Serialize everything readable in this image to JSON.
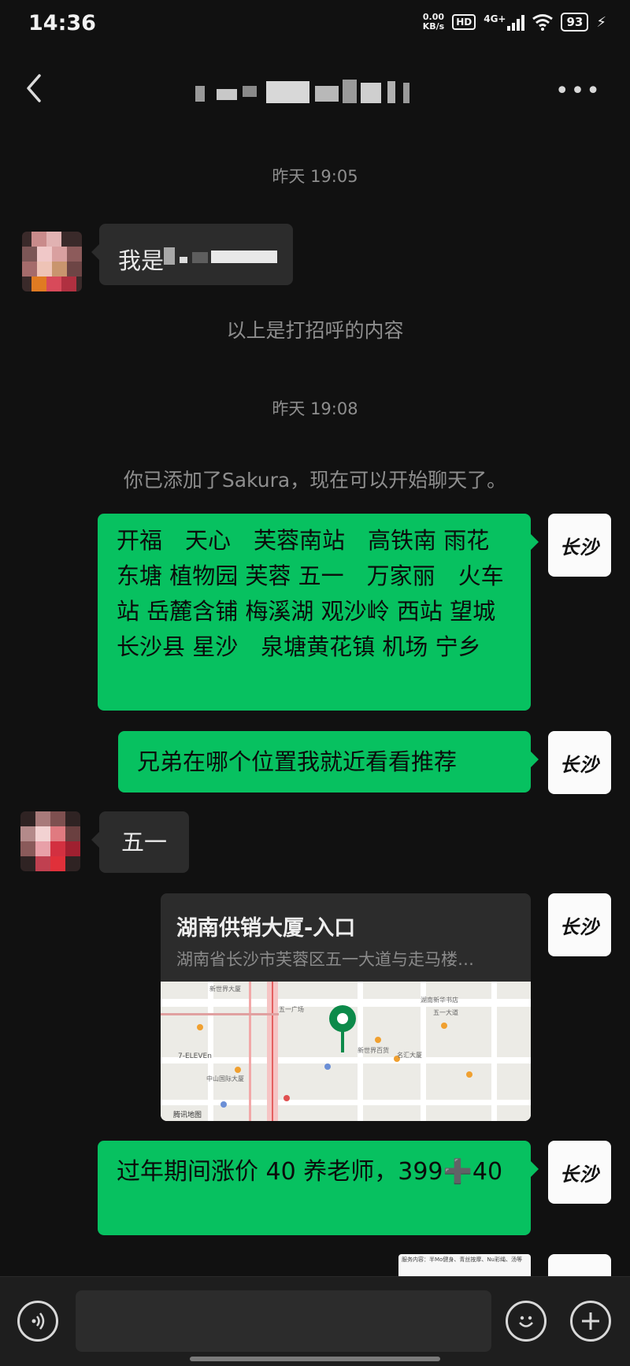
{
  "status_bar": {
    "time": "14:36",
    "net_speed_value": "0.00",
    "net_speed_unit": "KB/s",
    "hd": "HD",
    "network": "4G+",
    "battery": "93"
  },
  "header": {
    "back_icon": "chevron-left-icon",
    "more_label": "•••",
    "title_obscured": true
  },
  "chat": {
    "timestamp_1": "昨天 19:05",
    "greeting_msg": "我是",
    "greeting_note": "以上是打招呼的内容",
    "timestamp_2": "昨天 19:08",
    "added_notice": "你已添加了Sakura，现在可以开始聊天了。",
    "self_avatar_text": "长沙",
    "msg_areas": "开福　天心　芙蓉南站　高铁南 雨花 东塘 植物园 芙蓉 五一　万家丽　火车站 岳麓含铺 梅溪湖 观沙岭 西站 望城　长沙县 星沙　泉塘黄花镇 机场 宁乡",
    "msg_ask_location": "兄弟在哪个位置我就近看看推荐",
    "msg_reply_location": "五一",
    "location_card": {
      "title": "湖南供销大厦-入口",
      "address": "湖南省长沙市芙蓉区五一大道与走马楼…",
      "map_labels": [
        "新世界大厦",
        "五一广场",
        "湖南新华书店",
        "五一大道",
        "7-ELEVEn",
        "中山国际大厦",
        "新世界百货",
        "名汇大厦",
        "腾讯地图"
      ]
    },
    "msg_price": "过年期间涨价 40 养老师，399➕40",
    "image_preview_text": "服务内容：半Mo健身、青丝按摩、Nu彩绳、汤等"
  },
  "input_bar": {
    "voice_icon": "voice-icon",
    "emoji_icon": "emoji-icon",
    "plus_icon": "plus-icon",
    "input_value": ""
  }
}
